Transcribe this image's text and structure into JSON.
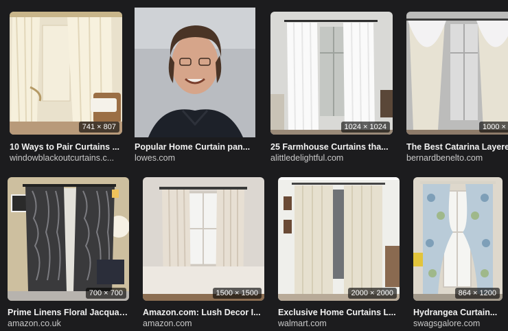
{
  "results": [
    {
      "title": "10 Ways to Pair Curtains ...",
      "source": "windowblackoutcurtains.c...",
      "dimensions": "741 × 807"
    },
    {
      "title": "Popular Home Curtain pan...",
      "source": "lowes.com",
      "dimensions": ""
    },
    {
      "title": "25 Farmhouse Curtains tha...",
      "source": "alittledelightful.com",
      "dimensions": "1024 × 1024"
    },
    {
      "title": "The Best Catarina Layere",
      "source": "bernardbenelto.com",
      "dimensions": "1000 ×"
    },
    {
      "title": "Prime Linens Floral Jacquar...",
      "source": "amazon.co.uk",
      "dimensions": "700 × 700"
    },
    {
      "title": "Amazon.com: Lush Decor I...",
      "source": "amazon.com",
      "dimensions": "1500 × 1500"
    },
    {
      "title": "Exclusive Home Curtains L...",
      "source": "walmart.com",
      "dimensions": "2000 × 2000"
    },
    {
      "title": "Hydrangea Curtain...",
      "source": "swagsgalore.com",
      "dimensions": "864 × 1200"
    }
  ],
  "colors": {
    "background": "#1c1c1e",
    "title_text": "#f2f2f2",
    "source_text": "#c9c9c9"
  }
}
